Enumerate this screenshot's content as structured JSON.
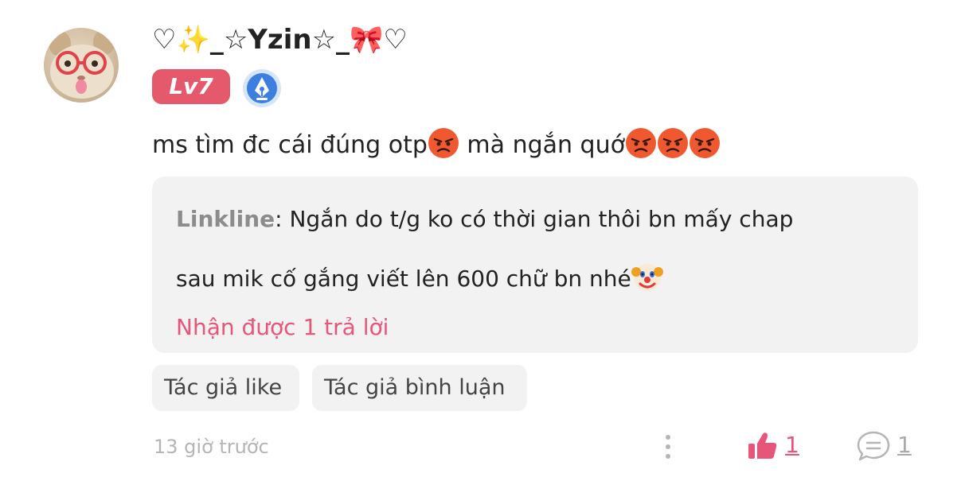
{
  "comment": {
    "username": "♡✨_☆Yzin☆_🎀♡",
    "level": "Lv7",
    "text_part1": "ms tìm đc cái đúng otp",
    "text_part2": " mà ngắn quớ",
    "timestamp": "13 giờ trước",
    "like_count": "1",
    "reply_count": "1"
  },
  "reply": {
    "author": "Linkline",
    "separator": ": ",
    "line1": "Ngắn do t/g ko có thời gian thôi bn mấy chap",
    "line2": "sau mik cố gắng viết lên 600 chữ bn nhé",
    "replies_link": "Nhận được 1 trả lời"
  },
  "tags": [
    "Tác giả like",
    "Tác giả bình luận"
  ],
  "icons": {
    "avatar": "cat-avatar",
    "writer_badge": "pen-nib-icon",
    "angry_emoji": "angry-face-emoji",
    "clown_emoji": "clown-face-emoji",
    "more": "vertical-dots-icon",
    "like": "thumbs-up-icon",
    "reply": "comment-bubble-icon"
  },
  "colors": {
    "accent": "#e8557a",
    "level_badge": "#e4596b",
    "writer_badge": "#3d7fe0",
    "muted": "#b5b5b5",
    "box_bg": "#f2f2f2"
  }
}
